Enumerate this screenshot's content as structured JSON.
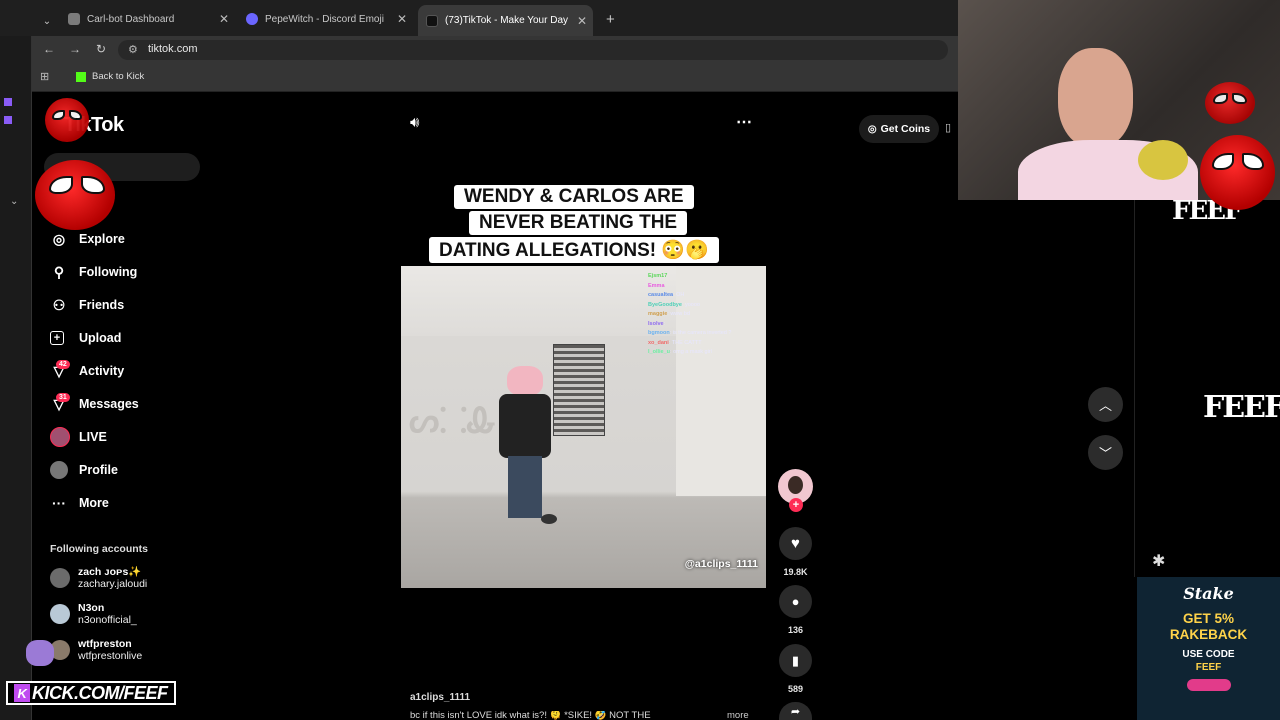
{
  "browser": {
    "tabs": [
      {
        "title": "Carl-bot Dashboard",
        "fav_color": "#7b7b7b"
      },
      {
        "title": "PepeWitch - Discord Emoji",
        "fav_color": "#6b66ff"
      },
      {
        "title": "(73)TikTok - Make Your Day",
        "fav_color": "#111111"
      }
    ],
    "url": "tiktok.com",
    "bookmark": "Back to Kick",
    "new_tab": "+"
  },
  "sidebar": {
    "logo": "TikTok",
    "items": [
      {
        "label": "Explore",
        "icon": "compass-icon"
      },
      {
        "label": "Following",
        "icon": "following-icon"
      },
      {
        "label": "Friends",
        "icon": "friends-icon"
      },
      {
        "label": "Upload",
        "icon": "upload-icon"
      },
      {
        "label": "Activity",
        "icon": "activity-icon",
        "badge": "42"
      },
      {
        "label": "Messages",
        "icon": "messages-icon",
        "badge": "31"
      },
      {
        "label": "LIVE",
        "icon": "live-icon"
      },
      {
        "label": "Profile",
        "icon": "profile-icon"
      },
      {
        "label": "More",
        "icon": "more-icon"
      }
    ],
    "following_title": "Following accounts",
    "accounts": [
      {
        "name": "zach ᴊᴏᴘs✨",
        "handle": "zachary.jaloudi"
      },
      {
        "name": "N3on",
        "handle": "n3onofficial_"
      },
      {
        "name": "wtfpreston",
        "handle": "wtfprestonlive"
      }
    ]
  },
  "top": {
    "get_coins": "Get Coins"
  },
  "video": {
    "caption_lines": [
      "WENDY & CARLOS ARE",
      "NEVER BEATING THE",
      "DATING ALLEGATIONS! 😳🫢"
    ],
    "watermark": "@a1clips_1111",
    "author": "a1clips_1111",
    "description": "bc if this isn't LOVE idk what is?! 🫠 *SIKE! 🤣 NOT THE",
    "more": "more",
    "chat": [
      {
        "user": "Ejsm17",
        "msg": ""
      },
      {
        "user": "Emma",
        "msg": ""
      },
      {
        "user": "casualtea",
        "msg": ": OH"
      },
      {
        "user": "ByeGoodbye",
        "msg": ": yoooo"
      },
      {
        "user": "maggie",
        "msg": ": www bd"
      },
      {
        "user": "Isolve",
        "msg": ":"
      },
      {
        "user": "bgmoon",
        "msg": ": is the camera inverted ?"
      },
      {
        "user": "xo_dani",
        "msg": ": THE CATTT"
      },
      {
        "user": "l_ollie_u",
        "msg": ": omg a mask girl"
      }
    ]
  },
  "actions": {
    "likes": "19.8K",
    "comments": "136",
    "saves": "589"
  },
  "overlay": {
    "kick_banner": "KICK.COM/FEEF",
    "feef_1": "FEEF",
    "feef_2": "FEEF",
    "stake": {
      "brand": "Stake",
      "line1": "GET 5%",
      "line2": "RAKEBACK",
      "line3": "USE CODE",
      "code": "FEEF"
    }
  }
}
